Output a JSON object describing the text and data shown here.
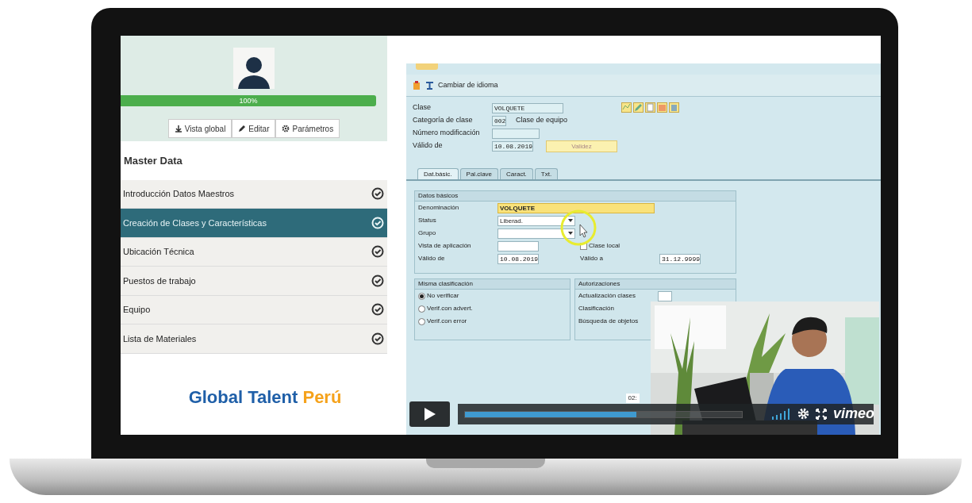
{
  "sidebar": {
    "progress": {
      "label": "100%",
      "level": 1
    },
    "buttons": [
      {
        "label": "Vista global",
        "kind": "download"
      },
      {
        "label": "Editar",
        "kind": "pencil"
      },
      {
        "label": "Parámetros",
        "kind": "gear"
      }
    ],
    "section_title": "Master Data",
    "lessons": [
      {
        "label": "Introducción Datos Maestros",
        "selected": false,
        "completed": true
      },
      {
        "label": "Creación de Clases y Características",
        "selected": true,
        "completed": true
      },
      {
        "label": "Ubicación Técnica",
        "selected": false,
        "completed": true
      },
      {
        "label": "Puestos de trabajo",
        "selected": false,
        "completed": true
      },
      {
        "label": "Equipo",
        "selected": false,
        "completed": true
      },
      {
        "label": "Lista de Materiales",
        "selected": false,
        "completed": true
      }
    ],
    "logo": {
      "main": "Global Talent",
      "accent": "Perú"
    }
  },
  "sap": {
    "toolbar": {
      "label": "Cambiar de idioma"
    },
    "header_fields": [
      {
        "label": "Clase",
        "value": "VOLQUETE"
      },
      {
        "label": "Categoría de clase",
        "value": "002",
        "note": "Clase de equipo"
      },
      {
        "label": "Número modificación"
      },
      {
        "label": "Válido de",
        "value": "10.08.2019"
      }
    ],
    "validity_button": "Validez",
    "tabs": [
      {
        "label": "Dat.básic.",
        "selected": true
      },
      {
        "label": "Pal.clave",
        "selected": false
      },
      {
        "label": "Caract.",
        "selected": false
      },
      {
        "label": "Txt.",
        "selected": false
      }
    ],
    "basic_data": {
      "title": "Datos básicos",
      "rows": [
        {
          "label": "Denominación",
          "value": "VOLQUETE",
          "kind": "required"
        },
        {
          "label": "Status",
          "value": "Liberad.",
          "kind": "dropdown"
        },
        {
          "label": "Grupo",
          "kind": "dropdown"
        },
        {
          "label": "Vista de aplicación",
          "kind": "text",
          "right": {
            "kind": "checkbox",
            "label": "Clase local",
            "checked": false
          }
        },
        {
          "label": "Válido de",
          "value": "10.08.2019",
          "kind": "date",
          "right": {
            "kind": "field",
            "label": "Válido a",
            "value": "31.12.9999"
          }
        }
      ]
    },
    "same_classification": {
      "title": "Misma clasificación",
      "options": [
        {
          "label": "No verificar",
          "selected": true
        },
        {
          "label": "Verif.con advert.",
          "selected": false
        },
        {
          "label": "Verif.con error",
          "selected": false
        }
      ]
    },
    "authorizations": {
      "title": "Autorizaciones",
      "rows": [
        "Actualización clases",
        "Clasificación",
        "Búsqueda de objetos"
      ]
    }
  },
  "video": {
    "time_tooltip": "02:",
    "level": 0.62,
    "brand": "vimeo"
  }
}
